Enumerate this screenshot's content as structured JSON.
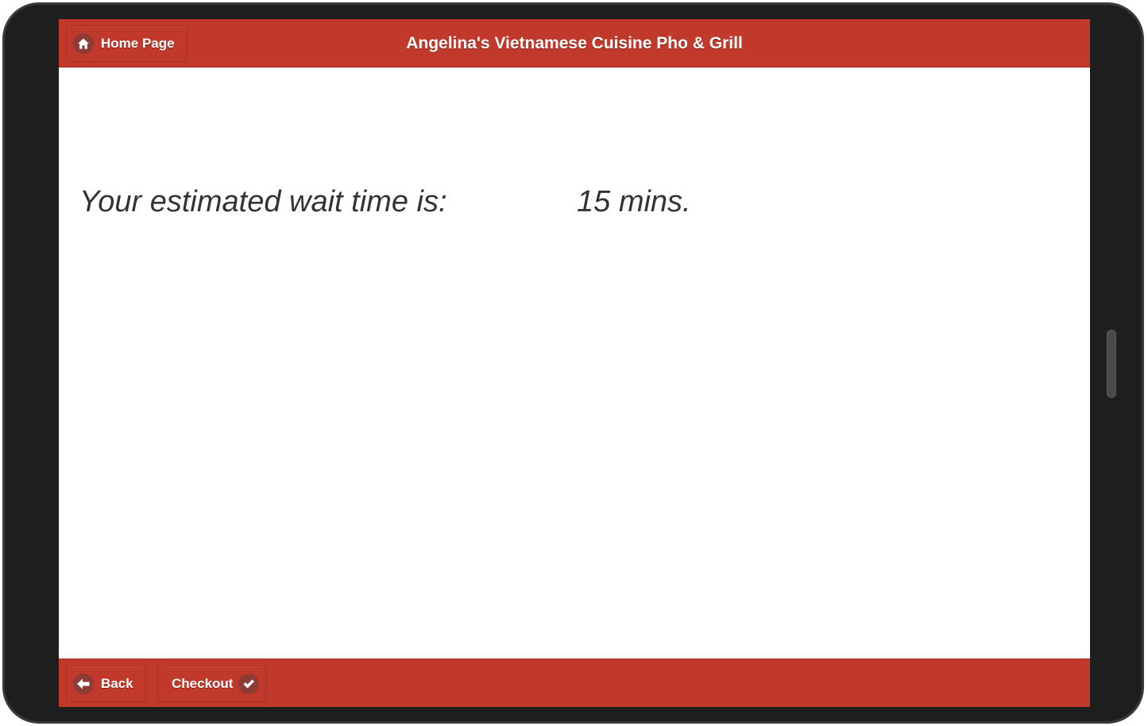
{
  "header": {
    "title": "Angelina's Vietnamese Cuisine Pho & Grill",
    "home_button": {
      "label": "Home Page",
      "icon": "home-icon"
    }
  },
  "main": {
    "wait_label": "Your estimated wait time is:",
    "wait_value": "15 mins."
  },
  "footer": {
    "back_button": {
      "label": "Back",
      "icon": "arrow-left-icon"
    },
    "checkout_button": {
      "label": "Checkout",
      "icon": "checkmark-icon"
    }
  },
  "colors": {
    "brand_red": "#c0392b",
    "icon_circle": "#8e3a35",
    "device_bezel": "#1e1e1e",
    "body_text": "#333333"
  }
}
